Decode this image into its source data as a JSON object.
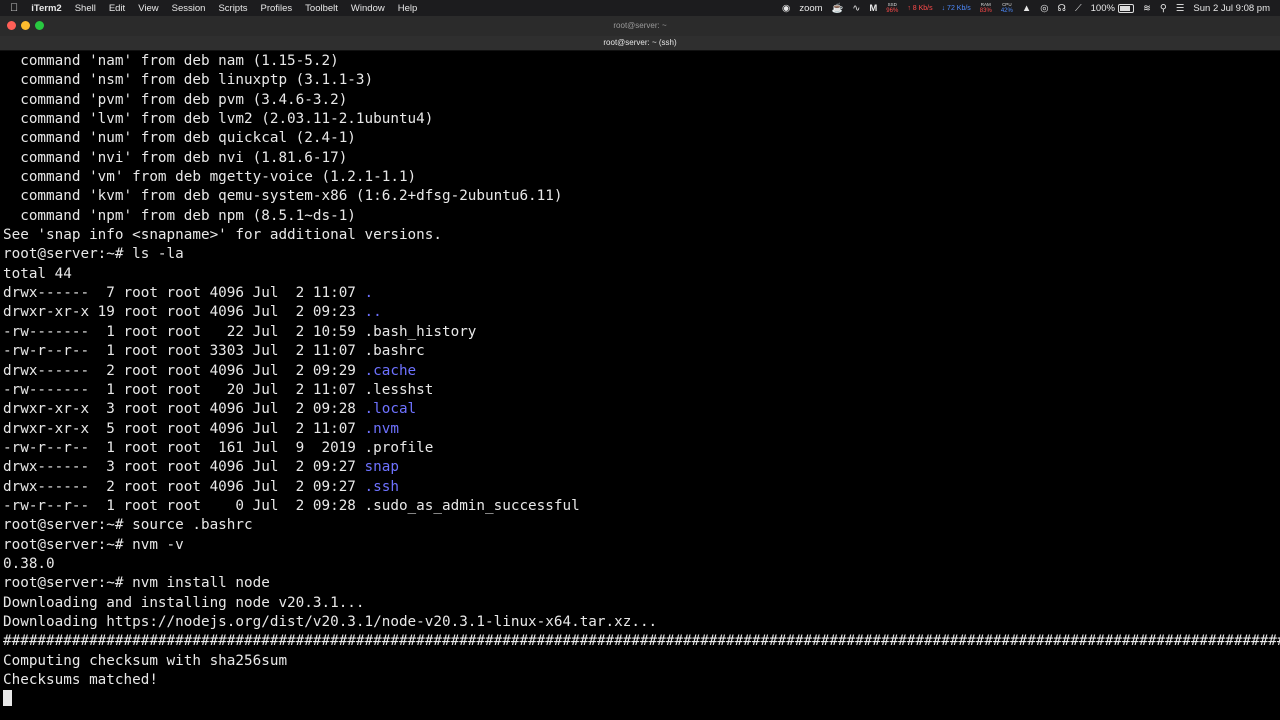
{
  "menubar": {
    "apple_icon": "apple-logo-icon",
    "app_name": "iTerm2",
    "menus": [
      "Shell",
      "Edit",
      "View",
      "Session",
      "Scripts",
      "Profiles",
      "Toolbelt",
      "Window",
      "Help"
    ],
    "zoom_label": "zoom",
    "ssd_label": "SSD",
    "ssd_value": "96%",
    "upload_speed": "↑ 8 Kb/s",
    "download_speed": "↓ 72 Kb/s",
    "ram_label": "RAM",
    "ram_value": "83%",
    "cpu_label": "CPU",
    "cpu_value": "42%",
    "battery_percent": "100%",
    "datetime": "Sun 2 Jul  9:08 pm",
    "colors": {
      "alert": "#ff4b4b",
      "accent": "#4e8cff"
    }
  },
  "window": {
    "title": "root@server: ~",
    "tab_title": "root@server: ~ (ssh)"
  },
  "terminal": {
    "colors": {
      "text": "#e8e8e8",
      "directory": "#6e72ff",
      "background": "#000000"
    },
    "lines_pre": [
      "  command 'nam' from deb nam (1.15-5.2)",
      "  command 'nsm' from deb linuxptp (3.1.1-3)",
      "  command 'pvm' from deb pvm (3.4.6-3.2)",
      "  command 'lvm' from deb lvm2 (2.03.11-2.1ubuntu4)",
      "  command 'num' from deb quickcal (2.4-1)",
      "  command 'nvi' from deb nvi (1.81.6-17)",
      "  command 'vm' from deb mgetty-voice (1.2.1-1.1)",
      "  command 'kvm' from deb qemu-system-x86 (1:6.2+dfsg-2ubuntu6.11)",
      "  command 'npm' from deb npm (8.5.1~ds-1)",
      "See 'snap info <snapname>' for additional versions.",
      "root@server:~# ls -la",
      "total 44"
    ],
    "listing": [
      {
        "meta": "drwx------  7 root root 4096 Jul  2 11:07 ",
        "name": ".",
        "is_dir": true
      },
      {
        "meta": "drwxr-xr-x 19 root root 4096 Jul  2 09:23 ",
        "name": "..",
        "is_dir": true
      },
      {
        "meta": "-rw-------  1 root root   22 Jul  2 10:59 ",
        "name": ".bash_history",
        "is_dir": false
      },
      {
        "meta": "-rw-r--r--  1 root root 3303 Jul  2 11:07 ",
        "name": ".bashrc",
        "is_dir": false
      },
      {
        "meta": "drwx------  2 root root 4096 Jul  2 09:29 ",
        "name": ".cache",
        "is_dir": true
      },
      {
        "meta": "-rw-------  1 root root   20 Jul  2 11:07 ",
        "name": ".lesshst",
        "is_dir": false
      },
      {
        "meta": "drwxr-xr-x  3 root root 4096 Jul  2 09:28 ",
        "name": ".local",
        "is_dir": true
      },
      {
        "meta": "drwxr-xr-x  5 root root 4096 Jul  2 11:07 ",
        "name": ".nvm",
        "is_dir": true
      },
      {
        "meta": "-rw-r--r--  1 root root  161 Jul  9  2019 ",
        "name": ".profile",
        "is_dir": false
      },
      {
        "meta": "drwx------  3 root root 4096 Jul  2 09:27 ",
        "name": "snap",
        "is_dir": true
      },
      {
        "meta": "drwx------  2 root root 4096 Jul  2 09:27 ",
        "name": ".ssh",
        "is_dir": true
      },
      {
        "meta": "-rw-r--r--  1 root root    0 Jul  2 09:28 ",
        "name": ".sudo_as_admin_successful",
        "is_dir": false
      }
    ],
    "lines_post": [
      "root@server:~# source .bashrc",
      "root@server:~# nvm -v",
      "0.38.0",
      "root@server:~# nvm install node",
      "Downloading and installing node v20.3.1...",
      "Downloading https://nodejs.org/dist/v20.3.1/node-v20.3.1-linux-x64.tar.xz..."
    ],
    "progress_bar": "#########################################################################################################################################################",
    "lines_after_progress": [
      "Computing checksum with sha256sum",
      "Checksums matched!"
    ]
  }
}
